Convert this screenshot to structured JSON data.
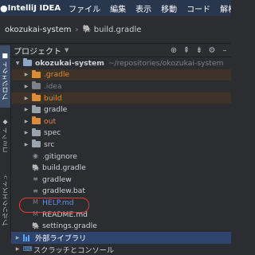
{
  "menubar": {
    "apple": "",
    "app_name": "IntelliJ IDEA",
    "items": [
      "ファイル",
      "編集",
      "表示",
      "移動",
      "コード",
      "解析"
    ]
  },
  "titlebar": {
    "project": "okozukai-system",
    "file": "build.gradle"
  },
  "side_tabs": [
    {
      "label": "プロジェクト",
      "active": true
    },
    {
      "label": "コミット",
      "active": false
    },
    {
      "label": "プルリクエスト",
      "active": false
    }
  ],
  "project_panel": {
    "title": "プロジェクト",
    "tools": [
      "locate-icon",
      "collapse-all-icon",
      "expand-all-icon",
      "settings-icon",
      "hide-icon"
    ]
  },
  "tree": [
    {
      "name": "okozukai-system",
      "path": "~/repositories/okozukai-system",
      "kind": "root",
      "depth": 0,
      "expanded": true
    },
    {
      "name": ".gradle",
      "kind": "folder",
      "depth": 1,
      "color": "#d98c3a",
      "bg": "#3d3328"
    },
    {
      "name": ".idea",
      "kind": "folder",
      "depth": 1,
      "color": "#7d8187",
      "bg": ""
    },
    {
      "name": "build",
      "kind": "folder",
      "depth": 1,
      "color": "#d98c3a",
      "bg": "#3d3328"
    },
    {
      "name": "gradle",
      "kind": "folder",
      "depth": 1,
      "color": "#cdd1d6",
      "bg": ""
    },
    {
      "name": "out",
      "kind": "folder",
      "depth": 1,
      "color": "#d98c3a",
      "bg": ""
    },
    {
      "name": "spec",
      "kind": "folder",
      "depth": 1,
      "color": "#cdd1d6",
      "bg": ""
    },
    {
      "name": "src",
      "kind": "folder",
      "depth": 1,
      "color": "#cdd1d6",
      "bg": ""
    },
    {
      "name": ".gitignore",
      "kind": "file",
      "depth": 1,
      "icon": "gitignore-icon",
      "color": "#cdd1d6"
    },
    {
      "name": "build.gradle",
      "kind": "file",
      "depth": 1,
      "icon": "gradle-icon",
      "color": "#cdd1d6"
    },
    {
      "name": "gradlew",
      "kind": "file",
      "depth": 1,
      "icon": "text-file-icon",
      "color": "#cdd1d6"
    },
    {
      "name": "gradlew.bat",
      "kind": "file",
      "depth": 1,
      "icon": "text-file-icon",
      "color": "#cdd1d6"
    },
    {
      "name": "HELP.md",
      "kind": "file",
      "depth": 1,
      "icon": "markdown-icon",
      "color": "#5b93e6"
    },
    {
      "name": "README.md",
      "kind": "file",
      "depth": 1,
      "icon": "markdown-icon",
      "color": "#cdd1d6"
    },
    {
      "name": "settings.gradle",
      "kind": "file",
      "depth": 1,
      "icon": "gradle-icon",
      "color": "#cdd1d6"
    },
    {
      "name": "外部ライブラリ",
      "kind": "library",
      "depth": 0,
      "selected": true,
      "color": "#ffffff"
    },
    {
      "name": "スクラッチとコンソール",
      "kind": "scratch",
      "depth": 0,
      "color": "#cdd1d6"
    }
  ]
}
